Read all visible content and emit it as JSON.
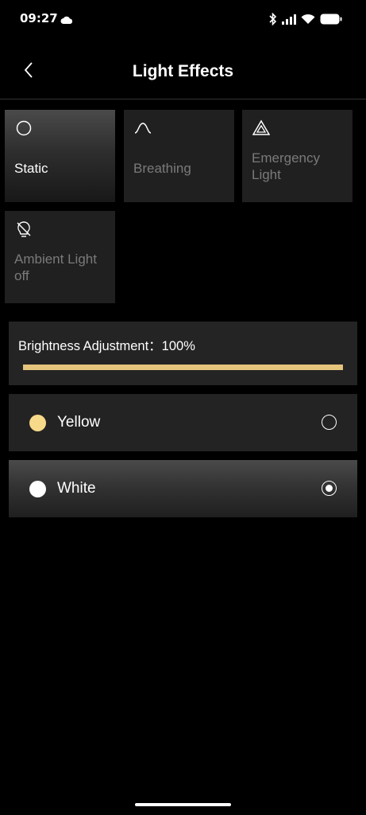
{
  "status_bar": {
    "time": "09:27",
    "icons": [
      "cloud-icon",
      "bluetooth-icon",
      "signal-icon",
      "wifi-icon",
      "battery-icon"
    ]
  },
  "header": {
    "title": "Light Effects",
    "back_icon": "chevron-left-icon"
  },
  "effects": [
    {
      "label": "Static",
      "icon": "circle-icon",
      "active": true
    },
    {
      "label": "Breathing",
      "icon": "bell-curve-icon",
      "active": false
    },
    {
      "label": "Emergency Light",
      "icon": "warning-triangle-icon",
      "active": false
    },
    {
      "label": "Ambient Light off",
      "icon": "bulb-off-icon",
      "active": false
    }
  ],
  "brightness": {
    "label": "Brightness Adjustment：100%",
    "value_percent": 100
  },
  "colors": [
    {
      "label": "Yellow",
      "swatch": "#f7d98a",
      "selected": false
    },
    {
      "label": "White",
      "swatch": "#ffffff",
      "selected": true
    }
  ],
  "theme": {
    "accent": "#e5c47c",
    "background": "#000000",
    "card": "#232323"
  }
}
